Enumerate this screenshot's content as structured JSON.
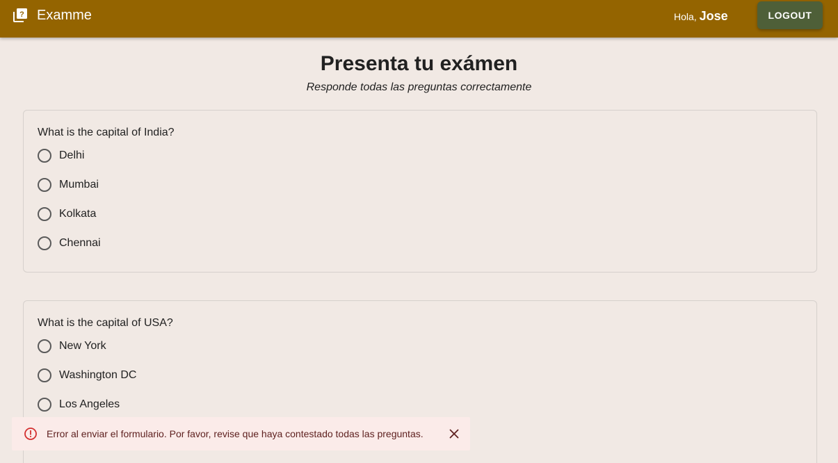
{
  "header": {
    "app_name": "Examme",
    "logo_icon": "quiz-icon",
    "greeting_prefix": "Hola,",
    "user_name": "Jose",
    "logout_label": "LOGOUT",
    "bar_color": "#946400",
    "logout_color": "#4e5f38"
  },
  "page": {
    "title": "Presenta tu exámen",
    "subtitle": "Responde todas las preguntas correctamente"
  },
  "questions": [
    {
      "text": "What is the capital of India?",
      "options": [
        "Delhi",
        "Mumbai",
        "Kolkata",
        "Chennai"
      ],
      "selected": null
    },
    {
      "text": "What is the capital of USA?",
      "options": [
        "New York",
        "Washington DC",
        "Los Angeles"
      ],
      "selected": null
    }
  ],
  "alert": {
    "severity": "error",
    "icon": "error-outline-icon",
    "message": "Error al enviar el formulario. Por favor, revise que haya contestado todas las preguntas.",
    "close_icon": "close-icon",
    "color": "#d32f2f"
  }
}
